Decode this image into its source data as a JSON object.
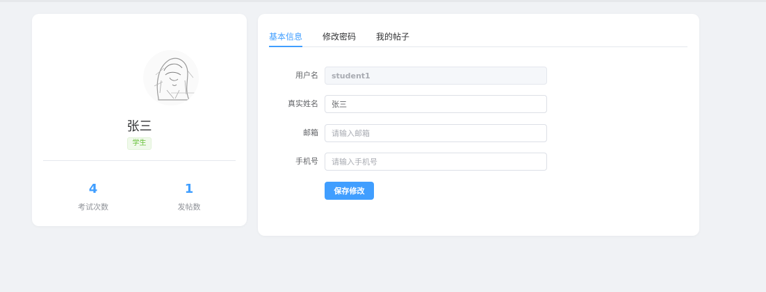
{
  "profile": {
    "name": "张三",
    "role": "学生",
    "stats": [
      {
        "value": "4",
        "label": "考试次数"
      },
      {
        "value": "1",
        "label": "发帖数"
      }
    ]
  },
  "tabs": [
    {
      "label": "基本信息",
      "active": true
    },
    {
      "label": "修改密码",
      "active": false
    },
    {
      "label": "我的帖子",
      "active": false
    }
  ],
  "form": {
    "username": {
      "label": "用户名",
      "value": "student1",
      "disabled": true
    },
    "realname": {
      "label": "真实姓名",
      "value": "张三"
    },
    "email": {
      "label": "邮箱",
      "value": "",
      "placeholder": "请输入邮箱"
    },
    "phone": {
      "label": "手机号",
      "value": "",
      "placeholder": "请输入手机号"
    },
    "save_label": "保存修改"
  },
  "colors": {
    "primary": "#409eff",
    "success_tag": "#67c23a",
    "background": "#f0f2f5"
  }
}
